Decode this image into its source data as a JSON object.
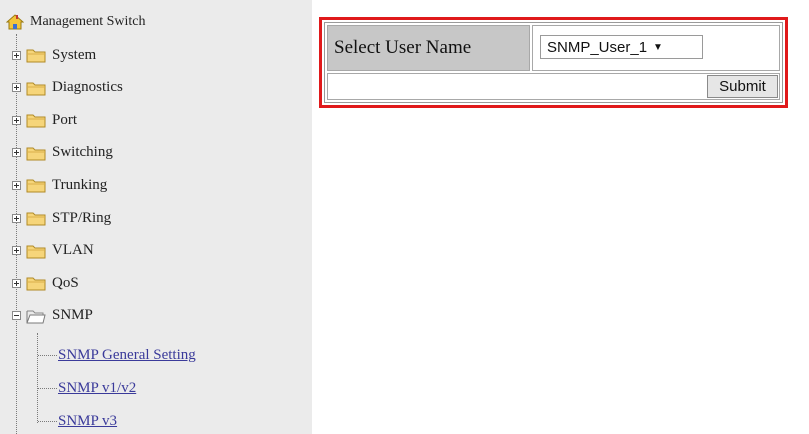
{
  "tree": {
    "root_label": "Management Switch",
    "folders": [
      {
        "label": "System",
        "state": "collapsed"
      },
      {
        "label": "Diagnostics",
        "state": "collapsed"
      },
      {
        "label": "Port",
        "state": "collapsed"
      },
      {
        "label": "Switching",
        "state": "collapsed"
      },
      {
        "label": "Trunking",
        "state": "collapsed"
      },
      {
        "label": "STP/Ring",
        "state": "collapsed"
      },
      {
        "label": "VLAN",
        "state": "collapsed"
      },
      {
        "label": "QoS",
        "state": "collapsed"
      },
      {
        "label": "SNMP",
        "state": "expanded"
      }
    ],
    "snmp_links": [
      "SNMP General Setting",
      "SNMP v1/v2",
      "SNMP v3"
    ]
  },
  "form": {
    "user_name_label": "Select User Name",
    "user_name_value": "SNMP_User_1",
    "submit_label": "Submit",
    "highlight_color": "#e0191b"
  },
  "colors": {
    "tree_bg": "#ebebeb",
    "label_cell_bg": "#c7c7c7",
    "link": "#3a3a9a"
  }
}
